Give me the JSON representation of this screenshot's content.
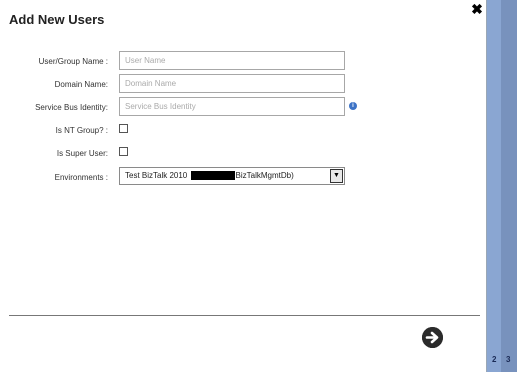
{
  "dialog": {
    "title": "Add New Users",
    "close_symbol": "✖"
  },
  "form": {
    "user_group": {
      "label": "User/Group Name :",
      "placeholder": "User Name",
      "value": ""
    },
    "domain": {
      "label": "Domain Name:",
      "placeholder": "Domain Name",
      "value": ""
    },
    "service_bus": {
      "label": "Service Bus Identity:",
      "placeholder": "Service Bus Identity",
      "value": ""
    },
    "is_nt_group": {
      "label": "Is NT Group? :",
      "checked": false
    },
    "is_super_user": {
      "label": "Is Super User:",
      "checked": false
    },
    "environments": {
      "label": "Environments :",
      "selected_prefix": "Test BizTalk 2010",
      "selected_suffix": "BizTalkMgmtDb)"
    }
  },
  "icons": {
    "info": "info-icon",
    "next": "arrow-right-circle-icon",
    "close": "close-icon",
    "dropdown": "chevron-down-icon"
  },
  "side_panel": {
    "pages": [
      "2",
      "3"
    ]
  },
  "colors": {
    "side_panel": "#8aa6d2",
    "info_icon": "#3d73c6",
    "next_button": "#2b2b2b"
  }
}
